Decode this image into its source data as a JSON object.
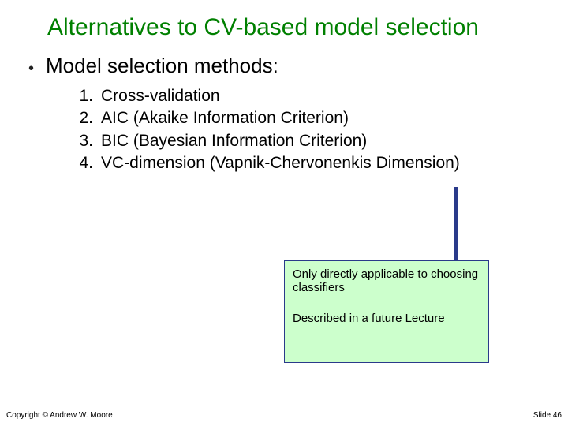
{
  "title": "Alternatives to CV-based model selection",
  "section": {
    "bullet": "•",
    "label": "Model selection methods:"
  },
  "list": {
    "items": [
      {
        "num": "1.",
        "text": "Cross-validation"
      },
      {
        "num": "2.",
        "text": "AIC (Akaike Information Criterion)"
      },
      {
        "num": "3.",
        "text": "BIC (Bayesian Information Criterion)"
      },
      {
        "num": "4.",
        "text": "VC-dimension (Vapnik-Chervonenkis  Dimension)"
      }
    ]
  },
  "callout": {
    "line1": "Only directly applicable to choosing classifiers",
    "line2": "Described in a future Lecture"
  },
  "footer": {
    "left": "Copyright © Andrew W. Moore",
    "right": "Slide 46"
  }
}
